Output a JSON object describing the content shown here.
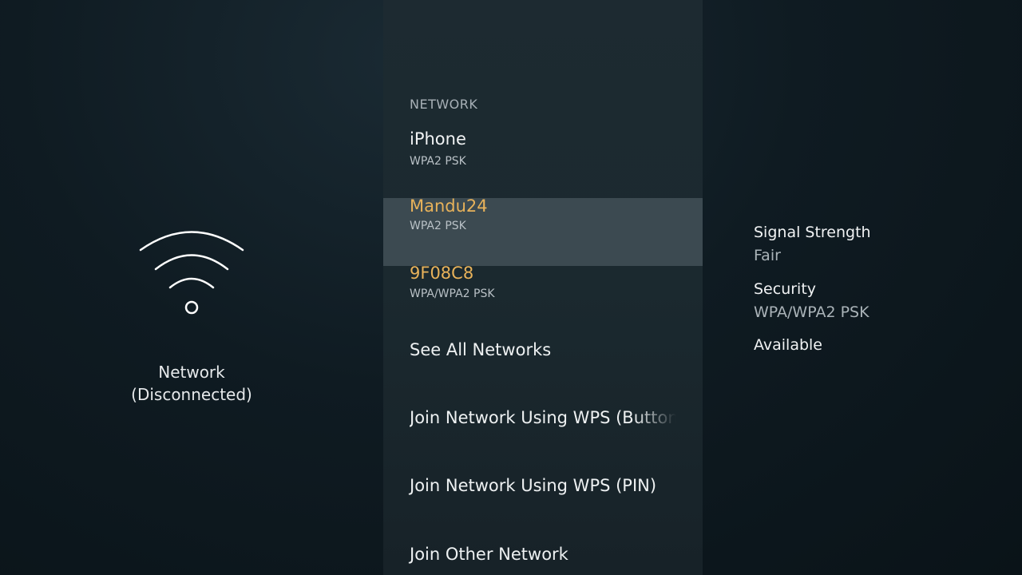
{
  "left": {
    "title": "Network",
    "status": "(Disconnected)",
    "icon": "wifi-icon"
  },
  "middle": {
    "section_header": "NETWORK",
    "networks": [
      {
        "name": "iPhone",
        "security": "WPA2 PSK",
        "selected": false
      },
      {
        "name": "Mandu24",
        "security": "WPA2 PSK",
        "selected": true
      },
      {
        "name": "9F08C8",
        "security": "WPA/WPA2 PSK",
        "selected": false
      }
    ],
    "actions": [
      "See All Networks",
      "Join Network Using WPS (Button)",
      "Join Network Using WPS (PIN)",
      "Join Other Network"
    ]
  },
  "details": {
    "signal_label": "Signal Strength",
    "signal_value": "Fair",
    "security_label": "Security",
    "security_value": "WPA/WPA2 PSK",
    "availability": "Available"
  },
  "colors": {
    "accent": "#e8b25a",
    "selected_bg": "#3c4a51"
  }
}
